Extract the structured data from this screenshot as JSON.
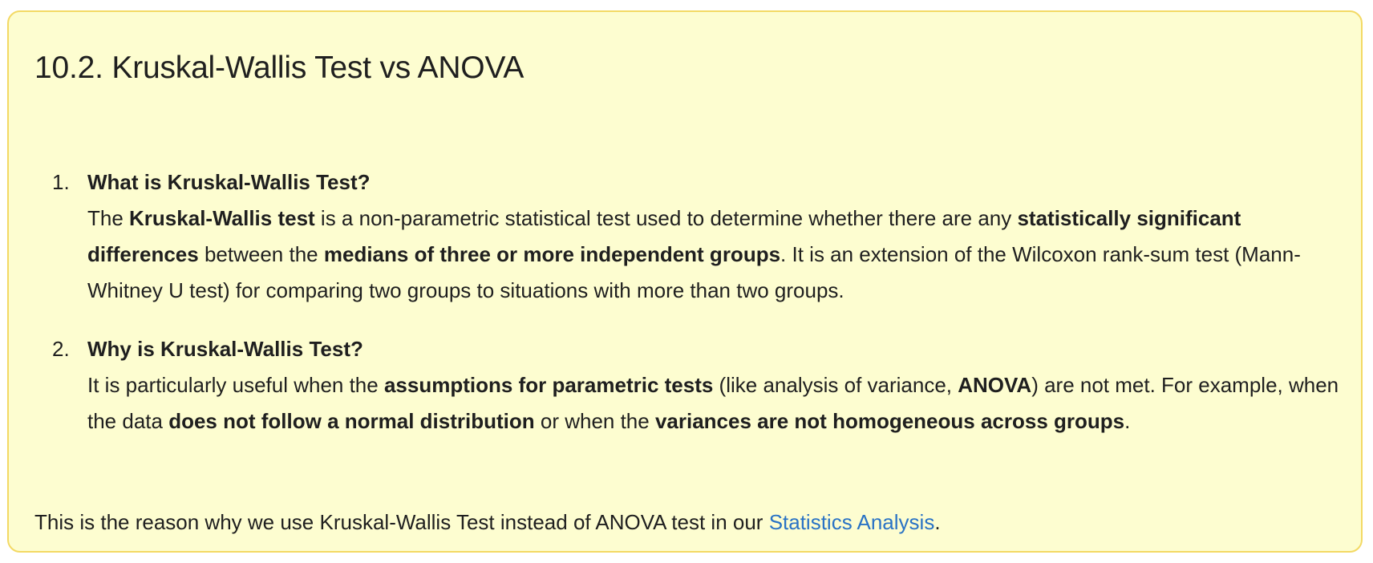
{
  "title": "10.2. Kruskal-Wallis Test vs ANOVA",
  "items": [
    {
      "marker": "1.",
      "heading": "What is Kruskal-Wallis Test?",
      "segments": [
        {
          "t": "The ",
          "b": false
        },
        {
          "t": "Kruskal-Wallis test",
          "b": true
        },
        {
          "t": " is a non-parametric statistical test used to determine whether there are any ",
          "b": false
        },
        {
          "t": "statistically significant differences",
          "b": true
        },
        {
          "t": " between the ",
          "b": false
        },
        {
          "t": "medians of three or more independent groups",
          "b": true
        },
        {
          "t": ". It is an extension of the Wilcoxon rank-sum test (Mann-Whitney U test) for comparing two groups to situations with more than two groups.",
          "b": false
        }
      ]
    },
    {
      "marker": "2.",
      "heading": "Why is Kruskal-Wallis Test?",
      "segments": [
        {
          "t": "It is particularly useful when the ",
          "b": false
        },
        {
          "t": "assumptions for parametric tests",
          "b": true
        },
        {
          "t": " (like analysis of variance, ",
          "b": false
        },
        {
          "t": "ANOVA",
          "b": true
        },
        {
          "t": ") are not met. For example, when the data ",
          "b": false
        },
        {
          "t": "does not follow a normal distribution",
          "b": true
        },
        {
          "t": " or when the ",
          "b": false
        },
        {
          "t": "variances are not homogeneous across groups",
          "b": true
        },
        {
          "t": ".",
          "b": false
        }
      ]
    }
  ],
  "footer": {
    "before": "This is the reason why we use Kruskal-Wallis Test instead of ANOVA test in our ",
    "link": "Statistics Analysis",
    "after": "."
  },
  "colors": {
    "background": "#fdfdd0",
    "border": "#f3d964",
    "link": "#2a73c5",
    "text": "#1f1f1f"
  }
}
